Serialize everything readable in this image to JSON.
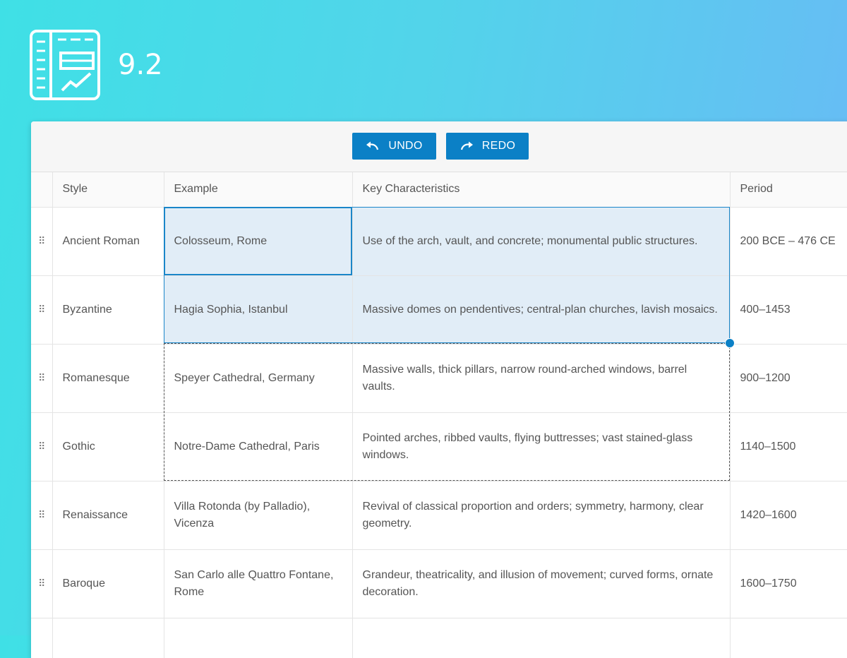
{
  "version": "9.2",
  "toolbar": {
    "undo_label": "UNDO",
    "redo_label": "REDO"
  },
  "colors": {
    "accent": "#0b80c6",
    "selection_fill": "#e1edf7",
    "selection_border": "#1a86c9"
  },
  "grid": {
    "columns": [
      "Style",
      "Example",
      "Key Characteristics",
      "Period"
    ],
    "rows": [
      {
        "style": "Ancient Roman",
        "example": "Colosseum, Rome",
        "characteristics": "Use of the arch, vault, and concrete; monumental public structures.",
        "period": "200 BCE – 476 CE"
      },
      {
        "style": "Byzantine",
        "example": "Hagia Sophia, Istanbul",
        "characteristics": "Massive domes on pendentives; central-plan churches, lavish mosaics.",
        "period": "400–1453"
      },
      {
        "style": "Romanesque",
        "example": "Speyer Cathedral, Germany",
        "characteristics": "Massive walls, thick pillars, narrow round-arched windows, barrel vaults.",
        "period": "900–1200"
      },
      {
        "style": "Gothic",
        "example": "Notre-Dame Cathedral, Paris",
        "characteristics": "Pointed arches, ribbed vaults, flying buttresses; vast stained-glass windows.",
        "period": "1140–1500"
      },
      {
        "style": "Renaissance",
        "example": "Villa Rotonda (by Palladio), Vicenza",
        "characteristics": "Revival of classical proportion and orders; symmetry, harmony, clear geometry.",
        "period": "1420–1600"
      },
      {
        "style": "Baroque",
        "example": "San Carlo alle Quattro Fontane, Rome",
        "characteristics": "Grandeur, theatricality, and illusion of movement; curved forms, ornate decoration.",
        "period": "1600–1750"
      },
      {
        "style": "",
        "example": "",
        "characteristics": "",
        "period": ""
      }
    ]
  }
}
